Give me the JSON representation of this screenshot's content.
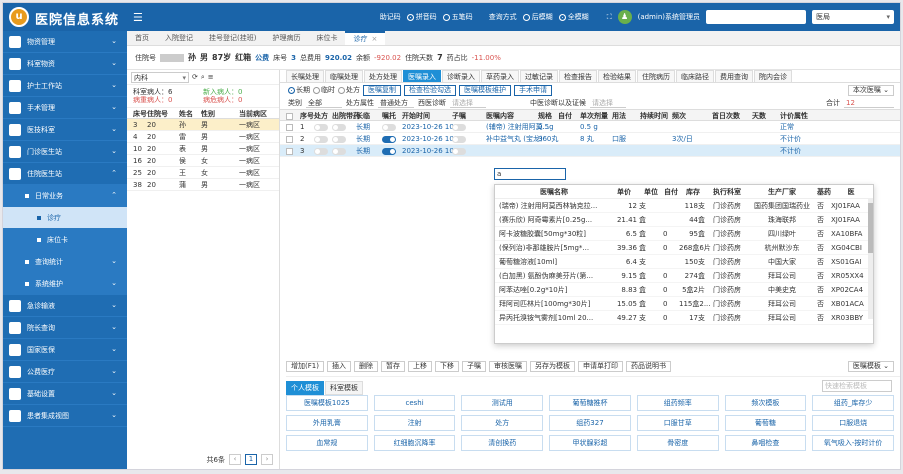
{
  "app": {
    "title": "医院信息系统",
    "logo_text": "u"
  },
  "header": {
    "label_assist": "助记码",
    "opt_pinyin": "拼音码",
    "opt_wubi": "五笔码",
    "label_query": "查询方式",
    "opt_prefix": "后模糊",
    "opt_full": "全模糊",
    "user": "(admin)系统管理员",
    "dept": "医局"
  },
  "sidebar": {
    "items": [
      {
        "label": "物资管理"
      },
      {
        "label": "科室物资"
      },
      {
        "label": "护士工作站"
      },
      {
        "label": "手术管理"
      },
      {
        "label": "医技科室"
      },
      {
        "label": "门诊医生站"
      },
      {
        "label": "住院医生站"
      }
    ],
    "sub_daily": "日常业务",
    "sub_treat": "诊疗",
    "sub_bed": "床位卡",
    "sub_query": "查询统计",
    "sub_sys": "系统维护",
    "more": [
      {
        "label": "急诊输液"
      },
      {
        "label": "院长查询"
      },
      {
        "label": "国家医保"
      },
      {
        "label": "公费医疗"
      },
      {
        "label": "基础设置"
      },
      {
        "label": "患者集成视图"
      }
    ]
  },
  "tabs": [
    {
      "label": "首页"
    },
    {
      "label": "入院登记"
    },
    {
      "label": "挂号登记(挂班)"
    },
    {
      "label": "护理病历"
    },
    {
      "label": "床位卡"
    },
    {
      "label": "诊疗"
    }
  ],
  "patient": {
    "label_no": "住院号",
    "name_tail": "孙",
    "sex": "男",
    "age": "87岁",
    "cat": "红箱",
    "insurance": "公费",
    "bed_label": "床号",
    "bed": "3",
    "fee_label": "总费用",
    "fee": "920.02",
    "balance_label": "余额",
    "balance": "-920.02",
    "days_label": "住院天数",
    "days": "7",
    "ratio_label": "药占比",
    "ratio": "-11.00%"
  },
  "leftpanel": {
    "dept": "内科",
    "stat_count_label": "科室病人：",
    "stat_count": "6",
    "stat_new_label": "新入病人：",
    "stat_new": "0",
    "stat_severe_label": "病重病人：",
    "stat_severe": "0",
    "stat_crit_label": "病危病人：",
    "stat_crit": "0",
    "cols": {
      "bed": "床号",
      "no": "住院号",
      "name": "姓名",
      "sex": "性别",
      "ward": "当前病区"
    },
    "rows": [
      {
        "bed": "3",
        "no": "20",
        "name": "孙",
        "sex": "男",
        "ward": "一病区"
      },
      {
        "bed": "4",
        "no": "20",
        "name": "雷",
        "sex": "男",
        "ward": "一病区"
      },
      {
        "bed": "10",
        "no": "20",
        "name": "表",
        "sex": "男",
        "ward": "一病区"
      },
      {
        "bed": "16",
        "no": "20",
        "name": "侯",
        "sex": "女",
        "ward": "一病区"
      },
      {
        "bed": "25",
        "no": "20",
        "name": "王",
        "sex": "女",
        "ward": "一病区"
      },
      {
        "bed": "38",
        "no": "20",
        "name": "蒲",
        "sex": "男",
        "ward": "一病区"
      }
    ],
    "total": "共6条",
    "page": "1"
  },
  "subtabs": [
    {
      "label": "长嘱处理"
    },
    {
      "label": "临嘱处理"
    },
    {
      "label": "处方处理"
    },
    {
      "label": "医嘱录入"
    },
    {
      "label": "诊断录入"
    },
    {
      "label": "草药录入"
    },
    {
      "label": "过敏记录"
    },
    {
      "label": "检查报告"
    },
    {
      "label": "检验结果"
    },
    {
      "label": "住院病历"
    },
    {
      "label": "临床路径"
    },
    {
      "label": "费用查询"
    },
    {
      "label": "院内会诊"
    }
  ],
  "ctrl": {
    "opt_long": "长期",
    "opt_temp": "临时",
    "opt_rx": "处方",
    "btn_copy": "医嘱复制",
    "btn_check": "检查检验勾选",
    "btn_tmpl": "医嘱模板维护",
    "btn_surgery": "手术申请",
    "btn_today": "本次医嘱"
  },
  "filter": {
    "label_class": "类别",
    "class": "全部",
    "label_attr": "处方属性",
    "attr": "普通处方",
    "label_west": "西医诊断",
    "west_ph": "请选择",
    "label_cn": "中医诊断以及证候",
    "cn_ph": "请选择",
    "label_total": "合计",
    "total": "12"
  },
  "grid": {
    "cols": [
      "序号",
      "处方",
      "出院带药",
      "长临",
      "嘱托",
      "开始时间",
      "子嘱",
      "医嘱内容",
      "规格",
      "自付",
      "单次剂量",
      "用法",
      "持续时间",
      "频次",
      "首日次数",
      "天数",
      "计价属性"
    ],
    "rows": [
      {
        "no": "1",
        "kind": "长期",
        "time": "2023-10-26 10...",
        "content": "(辅帝) 注射用阿莫...",
        "spec": "0.5g",
        "dose": "0.5 g",
        "usage": "",
        "freq": "",
        "price": "正常"
      },
      {
        "no": "2",
        "kind": "长期",
        "time": "2023-10-26 10...",
        "content": "补中益气丸 (宝龙)",
        "spec": "360丸",
        "dose": "8 丸",
        "usage": "口服",
        "freq": "3次/日",
        "price": "不计价"
      },
      {
        "no": "3",
        "kind": "长期",
        "time": "2023-10-26 10...",
        "content": "a",
        "spec": "",
        "dose": "",
        "usage": "",
        "freq": "",
        "price": "不计价"
      }
    ]
  },
  "dropdown": {
    "cols": {
      "name": "医嘱名称",
      "price": "单价",
      "unit": "单位",
      "self": "自付",
      "stock": "库存",
      "dept": "执行科室",
      "maker": "生产厂家",
      "base": "基药",
      "code": "医"
    },
    "rows": [
      {
        "name": "(瑞帝) 注射用阿莫西林钠克拉...",
        "price": "12",
        "unit": "支",
        "self": "",
        "stock": "118支",
        "dept": "门诊药房",
        "maker": "国药集团国瑞药业",
        "base": "否",
        "code": "XJ01FAA"
      },
      {
        "name": "(赛乐欣) 阿奇霉素片[0.25g...",
        "price": "21.41",
        "unit": "盒",
        "self": "",
        "stock": "44盒",
        "dept": "门诊药房",
        "maker": "珠海联邦",
        "base": "否",
        "code": "XJ01FAA"
      },
      {
        "name": "阿卡波糖胶囊[50mg*30粒]",
        "price": "6.5",
        "unit": "盒",
        "self": "0",
        "stock": "95盒",
        "dept": "门诊药房",
        "maker": "四川绿叶",
        "base": "否",
        "code": "XA10BFA"
      },
      {
        "name": "(保列治)非那雄胺片[5mg*...",
        "price": "39.36",
        "unit": "盒",
        "self": "0",
        "stock": "268盒6片",
        "dept": "门诊药房",
        "maker": "杭州默沙东",
        "base": "否",
        "code": "XG04CBI"
      },
      {
        "name": "葡萄糖溶液[10ml]",
        "price": "6.4",
        "unit": "支",
        "self": "",
        "stock": "150支",
        "dept": "门诊药房",
        "maker": "中国大家",
        "base": "否",
        "code": "XS01GAI"
      },
      {
        "name": "(白加黑) 氨酚伪麻美芬片(第...",
        "price": "9.15",
        "unit": "盒",
        "self": "0",
        "stock": "274盒",
        "dept": "门诊药房",
        "maker": "拜耳公司",
        "base": "否",
        "code": "XR05XX4"
      },
      {
        "name": "阿苯达唑[0.2g*10片]",
        "price": "8.83",
        "unit": "盒",
        "self": "0",
        "stock": "5盒2片",
        "dept": "门诊药房",
        "maker": "中美史克",
        "base": "否",
        "code": "XP02CA4"
      },
      {
        "name": "拜阿司匹林片[100mg*30片]",
        "price": "15.05",
        "unit": "盒",
        "self": "0",
        "stock": "115盒2...",
        "dept": "门诊药房",
        "maker": "拜耳公司",
        "base": "否",
        "code": "XB01ACA"
      },
      {
        "name": "异丙托溴铵气雾剂[10ml 20...",
        "price": "49.27",
        "unit": "支",
        "self": "0",
        "stock": "17支",
        "dept": "门诊药房",
        "maker": "拜耳公司",
        "base": "否",
        "code": "XR03BBY"
      }
    ]
  },
  "edit_value": "a",
  "bottom": {
    "buttons": [
      "增加(F1)",
      "插入",
      "删除",
      "暂存",
      "上移",
      "下移",
      "子嘱",
      "审核医嘱",
      "另存为模板",
      "申请单打印",
      "药品说明书"
    ],
    "right": "医嘱模板"
  },
  "templates": {
    "tab_personal": "个人模板",
    "tab_dept": "科室模板",
    "search_ph": "快速检索模板",
    "items": [
      "医嘱模板1025",
      "ceshi",
      "测试用",
      "葡萄糖推杯",
      "组药频率",
      "频次模板",
      "组药_库存少",
      "外用乳膏",
      "注射",
      "处方",
      "组药327",
      "口服甘草",
      "葡萄糖",
      "口服退烧",
      "血常规",
      "红细胞沉降率",
      "清创换药",
      "甲状腺彩超",
      "骨密度",
      "鼻咽检查",
      "氧气吸入-按时计价"
    ]
  }
}
